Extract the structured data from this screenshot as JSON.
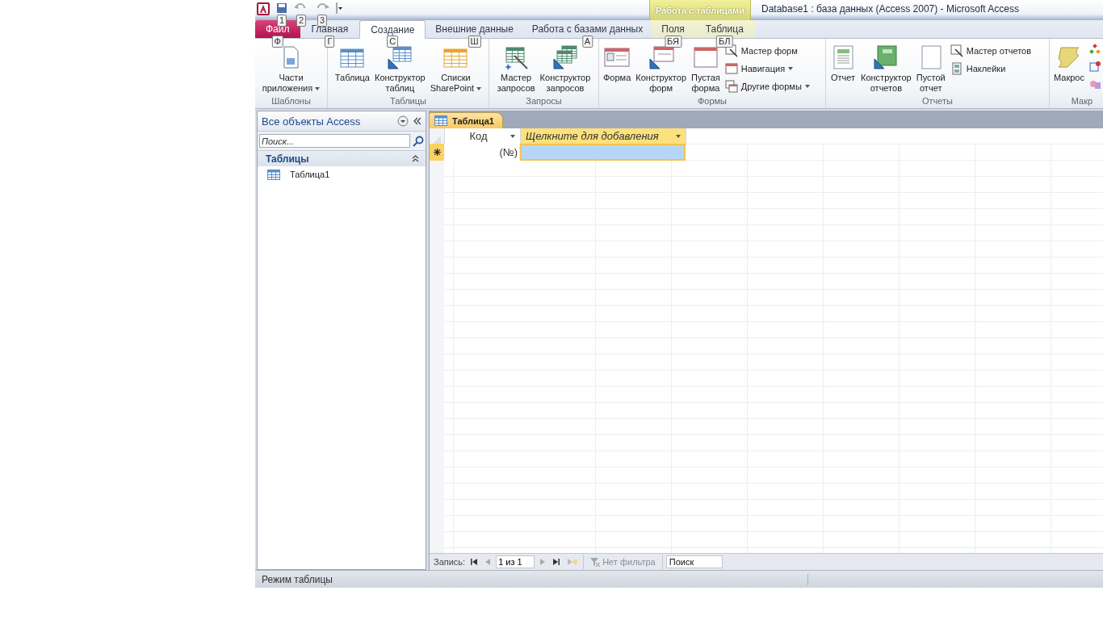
{
  "quick_access": {
    "keytips": [
      "1",
      "2",
      "3"
    ]
  },
  "context_group": {
    "title": "Работа с таблицами"
  },
  "window": {
    "title": "Database1 : база данных (Access 2007)  -  Microsoft Access"
  },
  "tabs": [
    {
      "label": "Файл",
      "keytip": "Ф",
      "kind": "file",
      "selected": false
    },
    {
      "label": "Главная",
      "keytip": "Г",
      "kind": "normal",
      "selected": false
    },
    {
      "label": "Создание",
      "keytip": "С",
      "kind": "normal",
      "selected": true
    },
    {
      "label": "Внешние данные",
      "keytip": "Ш",
      "kind": "normal",
      "selected": false
    },
    {
      "label": "Работа с базами данных",
      "keytip": "А",
      "kind": "normal",
      "selected": false
    },
    {
      "label": "Поля",
      "keytip": "БЯ",
      "kind": "context",
      "selected": false
    },
    {
      "label": "Таблица",
      "keytip": "БЛ",
      "kind": "context",
      "selected": false
    }
  ],
  "ribbon_groups": [
    {
      "title": "Шаблоны",
      "buttons": [
        {
          "kind": "large",
          "label_lines": [
            "Части",
            "приложения"
          ],
          "dropdown": true
        }
      ]
    },
    {
      "title": "Таблицы",
      "buttons": [
        {
          "kind": "large",
          "label_lines": [
            "Таблица"
          ],
          "dropdown": false
        },
        {
          "kind": "large",
          "label_lines": [
            "Конструктор",
            "таблиц"
          ],
          "dropdown": false
        },
        {
          "kind": "large",
          "label_lines": [
            "Списки",
            "SharePoint"
          ],
          "dropdown": true
        }
      ]
    },
    {
      "title": "Запросы",
      "buttons": [
        {
          "kind": "large",
          "label_lines": [
            "Мастер",
            "запросов"
          ],
          "dropdown": false
        },
        {
          "kind": "large",
          "label_lines": [
            "Конструктор",
            "запросов"
          ],
          "dropdown": false
        }
      ]
    },
    {
      "title": "Формы",
      "buttons": [
        {
          "kind": "large",
          "label_lines": [
            "Форма"
          ],
          "dropdown": false
        },
        {
          "kind": "large",
          "label_lines": [
            "Конструктор",
            "форм"
          ],
          "dropdown": false
        },
        {
          "kind": "large",
          "label_lines": [
            "Пустая",
            "форма"
          ],
          "dropdown": false
        },
        {
          "kind": "small",
          "label_lines": [
            "Мастер форм"
          ],
          "dropdown": false
        },
        {
          "kind": "small",
          "label_lines": [
            "Навигация"
          ],
          "dropdown": true
        },
        {
          "kind": "small",
          "label_lines": [
            "Другие формы"
          ],
          "dropdown": true
        }
      ]
    },
    {
      "title": "Отчеты",
      "buttons": [
        {
          "kind": "large",
          "label_lines": [
            "Отчет"
          ],
          "dropdown": false
        },
        {
          "kind": "large",
          "label_lines": [
            "Конструктор",
            "отчетов"
          ],
          "dropdown": false
        },
        {
          "kind": "large",
          "label_lines": [
            "Пустой",
            "отчет"
          ],
          "dropdown": false
        },
        {
          "kind": "small",
          "label_lines": [
            "Мастер отчетов"
          ],
          "dropdown": false
        },
        {
          "kind": "small",
          "label_lines": [
            "Наклейки"
          ],
          "dropdown": false
        }
      ]
    },
    {
      "title": "Макр",
      "buttons": [
        {
          "kind": "large",
          "label_lines": [
            "Макрос"
          ],
          "dropdown": false
        },
        {
          "kind": "tiny"
        },
        {
          "kind": "tiny"
        },
        {
          "kind": "tiny"
        }
      ]
    }
  ],
  "nav_pane": {
    "title": "Все объекты Access",
    "search": {
      "placeholder": "Поиск..."
    },
    "groups": [
      {
        "title": "Таблицы",
        "expanded": true,
        "items": [
          {
            "label": "Таблица1",
            "selected": false
          }
        ]
      }
    ]
  },
  "document_tabs": [
    {
      "label": "Таблица1",
      "selected": true
    }
  ],
  "datasheet": {
    "columns": [
      {
        "label": "Код",
        "kind": "field",
        "dropdown": true
      },
      {
        "label": "Щелкните для добавления",
        "kind": "add",
        "dropdown": true
      }
    ],
    "rows": [
      {
        "new_record": true,
        "cells": [
          {
            "text": "(№)",
            "selected": false
          },
          {
            "text": "",
            "selected": true
          }
        ]
      }
    ]
  },
  "record_nav": {
    "label": "Запись:",
    "position": "1 из 1",
    "filter": "Нет фильтра",
    "filter_active": false,
    "search": {
      "placeholder": "Поиск"
    }
  },
  "status_bar": {
    "text": "Режим таблицы"
  }
}
